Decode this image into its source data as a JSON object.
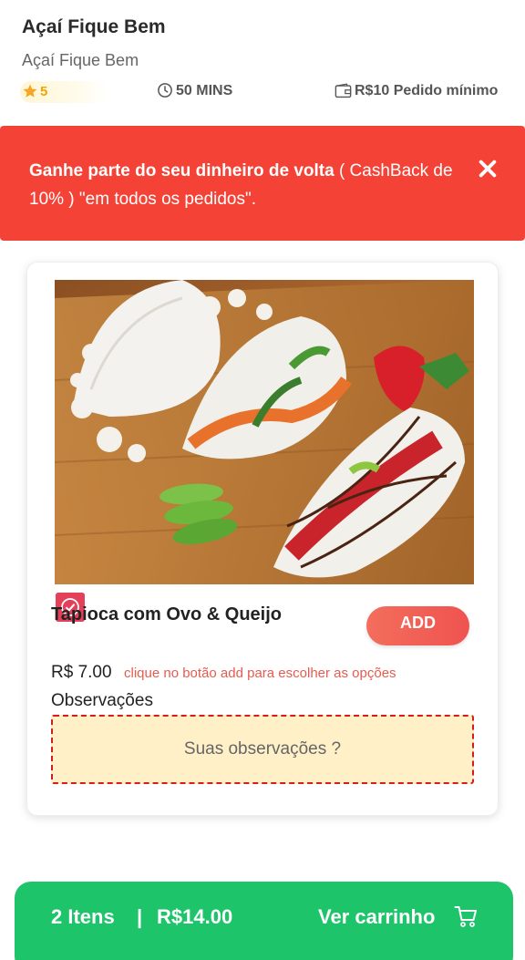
{
  "store": {
    "title": "Açaí Fique Bem",
    "subtitle": "Açaí Fique Bem",
    "rating": "5",
    "delivery_time": "50 MINS",
    "min_order": "R$10 Pedido mínimo"
  },
  "banner": {
    "bold_text": "Ganhe parte do seu dinheiro de volta",
    "rest_text": " ( CashBack de 10% ) \"em todos os pedidos\"."
  },
  "product": {
    "name": "Tapioca com Ovo & Queijo",
    "add_label": "ADD",
    "price": "R$ 7.00",
    "price_hint": "clique no botão add para escolher as opções",
    "notes_label": "Observações",
    "notes_placeholder": "Suas observações ?"
  },
  "cart": {
    "count_text": "2 Itens",
    "separator": "|",
    "total": "R$14.00",
    "view_label": "Ver carrinho"
  },
  "colors": {
    "banner": "#f44336",
    "cart_bar": "#1ec46a",
    "add_button": "#ef5350",
    "notes_border": "#d51d1d"
  },
  "icons": [
    "star-icon",
    "clock-icon",
    "wallet-icon",
    "close-icon",
    "check-badge-icon",
    "cart-icon"
  ]
}
